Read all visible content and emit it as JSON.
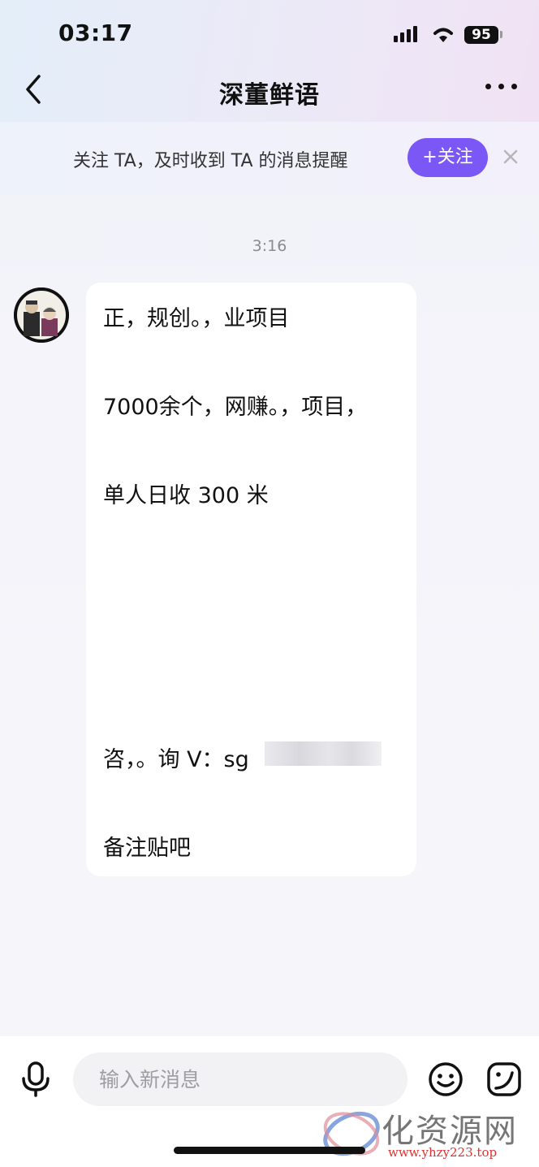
{
  "status_bar": {
    "time": "03:17",
    "battery": "95"
  },
  "header": {
    "title": "深董鲜语"
  },
  "follow_banner": {
    "text": "关注 TA，及时收到 TA 的消息提醒",
    "button_label": "+关注"
  },
  "chat": {
    "timestamp": "3:16",
    "message_lines": [
      "正，规创。，业项目",
      "7000余个，网赚。，项目，",
      "单人日收 300 米",
      "咨，。询 V：sg",
      "备注贴吧"
    ]
  },
  "composer": {
    "placeholder": "输入新消息"
  },
  "watermark": {
    "text": "化资源网",
    "url": "www.yhzy223.top"
  },
  "colors": {
    "accent": "#7b57f5"
  }
}
